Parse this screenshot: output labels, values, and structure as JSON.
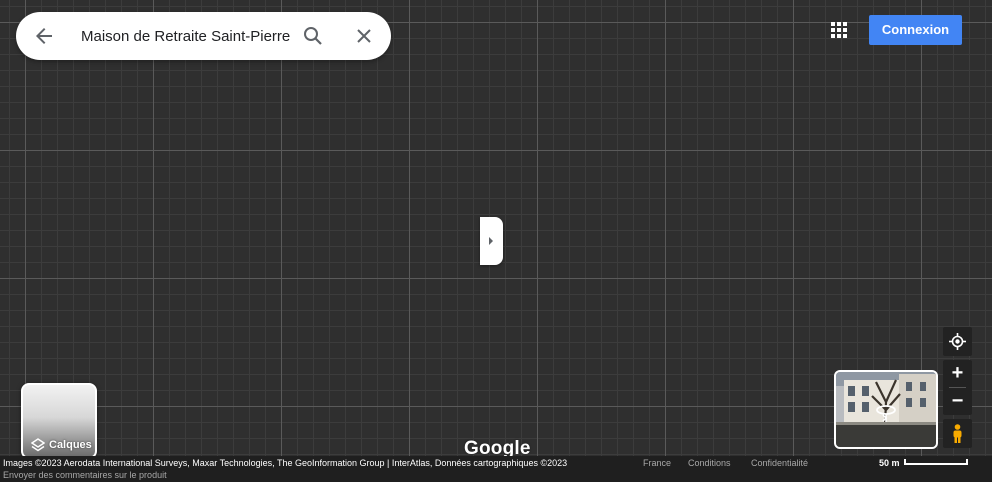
{
  "search": {
    "query": "Maison de Retraite Saint-Pierre",
    "back_icon": "arrow-back-icon",
    "search_icon": "search-icon",
    "close_icon": "close-icon"
  },
  "header": {
    "apps_icon": "apps-grid-icon",
    "signin_label": "Connexion"
  },
  "map": {
    "layers_label": "Calques",
    "google_logo": "Google",
    "panel_toggle_icon": "chevron-right-icon"
  },
  "controls": {
    "locate_icon": "my-location-icon",
    "zoom_in": "+",
    "zoom_out": "−",
    "pegman_icon": "pegman-icon",
    "streetview_icon": "rotate-360-icon"
  },
  "footer": {
    "attribution": "Images ©2023 Aerodata International Surveys, Maxar Technologies, The GeoInformation Group | InterAtlas, Données cartographiques ©2023",
    "feedback": "Envoyer des commentaires sur le produit",
    "country": "France",
    "terms": "Conditions",
    "privacy": "Confidentialité",
    "scale": "50 m"
  },
  "colors": {
    "map_background": "#2f2f2f",
    "signin_button": "#4285f4",
    "control_background": "#222222",
    "pegman": "#f9ab00"
  }
}
